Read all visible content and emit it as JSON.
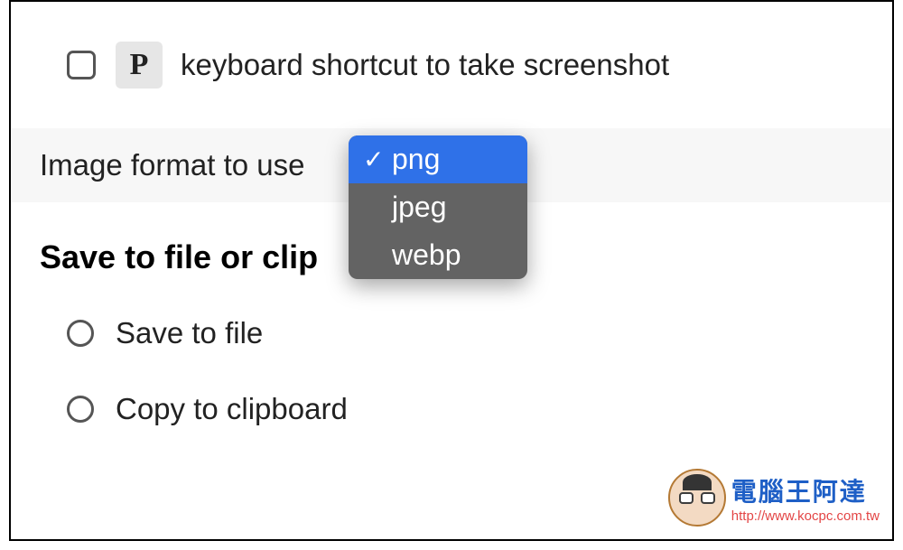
{
  "shortcut": {
    "key": "P",
    "label": "keyboard shortcut to take screenshot",
    "checked": false
  },
  "format": {
    "label": "Image format to use",
    "options": [
      "png",
      "jpeg",
      "webp"
    ],
    "selected": "png"
  },
  "save_section": {
    "heading": "Save to file or clip",
    "options": [
      {
        "label": "Save to file"
      },
      {
        "label": "Copy to clipboard"
      }
    ]
  },
  "watermark": {
    "title": "電腦王阿達",
    "url": "http://www.kocpc.com.tw"
  }
}
